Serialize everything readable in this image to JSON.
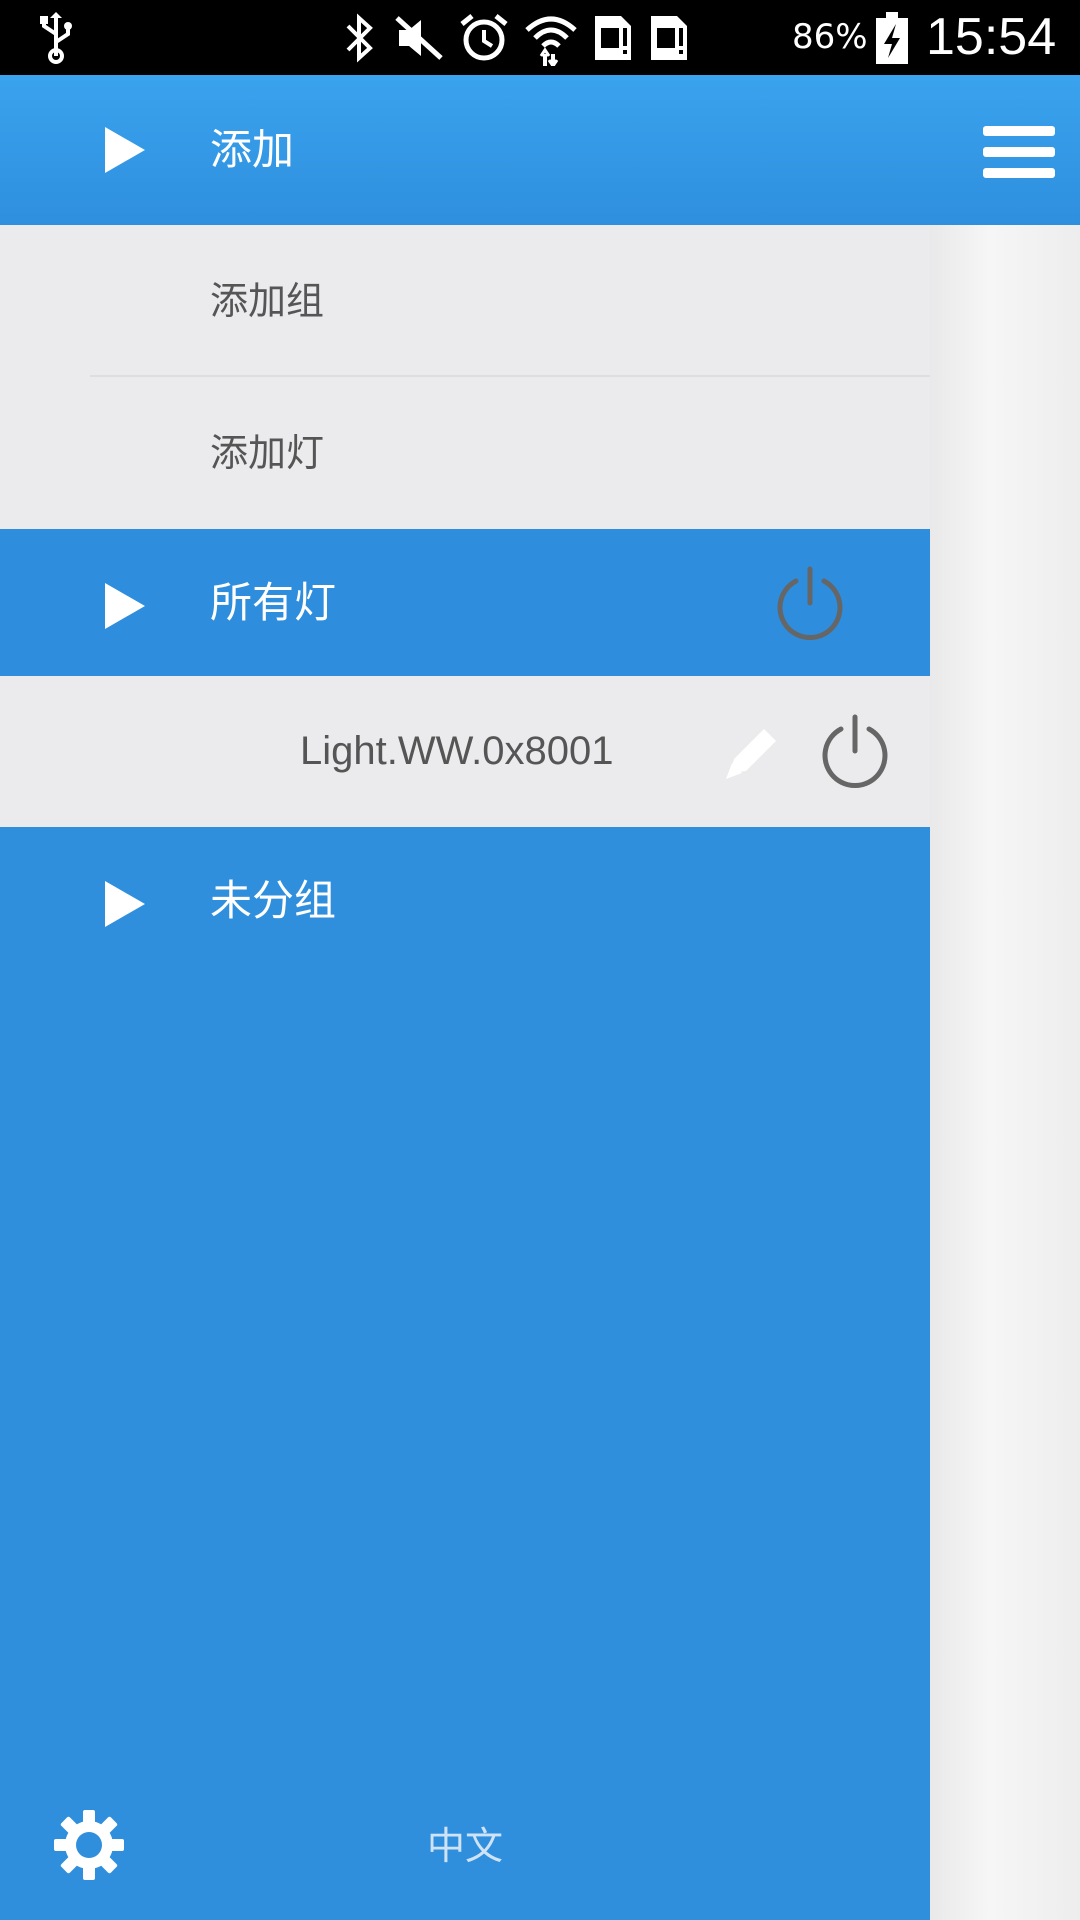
{
  "status_bar": {
    "battery_percent": "86%",
    "time": "15:54",
    "icons": [
      "usb-icon",
      "bluetooth-icon",
      "mute-icon",
      "alarm-icon",
      "wifi-icon",
      "sim1-icon",
      "sim2-icon",
      "battery-charging-icon"
    ]
  },
  "header": {
    "title": "添加",
    "menu_icon": "hamburger-menu-icon",
    "expand_icon": "play-triangle-icon"
  },
  "add_menu": {
    "items": [
      {
        "label": "添加组"
      },
      {
        "label": "添加灯"
      }
    ]
  },
  "groups": [
    {
      "label": "所有灯",
      "power_icon": "power-icon",
      "lights": [
        {
          "label": "Light.WW.0x8001",
          "edit_icon": "pencil-icon",
          "power_icon": "power-icon"
        }
      ]
    },
    {
      "label": "未分组"
    }
  ],
  "footer": {
    "settings_icon": "settings-gear-icon",
    "language_label": "中文"
  },
  "colors": {
    "header_blue": "#3aa3ee",
    "drawer_blue": "#2f8fdd",
    "submenu_gray": "#ebebed",
    "text_gray": "#555555"
  }
}
